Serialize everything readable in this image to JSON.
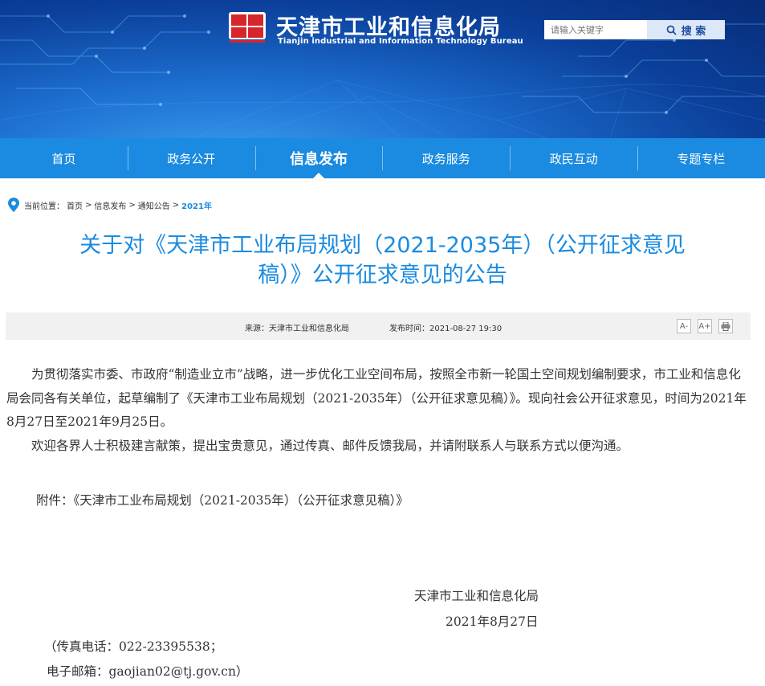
{
  "header": {
    "title_cn": "天津市工业和信息化局",
    "title_en": "Tianjin industrial and Information Technology Bureau",
    "search": {
      "placeholder": "请输入关键字",
      "button": "搜 索"
    }
  },
  "nav": {
    "items": [
      {
        "label": "首页"
      },
      {
        "label": "政务公开"
      },
      {
        "label": "信息发布"
      },
      {
        "label": "政务服务"
      },
      {
        "label": "政民互动"
      },
      {
        "label": "专题专栏"
      }
    ],
    "active_index": 2
  },
  "breadcrumb": {
    "prefix": "当前位置：",
    "items": [
      "首页",
      "信息发布",
      "通知公告",
      "2021年"
    ],
    "separator": ">"
  },
  "article": {
    "title_line1": "关于对《天津市工业布局规划（2021-2035年）（公开征求意见",
    "title_line2": "稿）》公开征求意见的公告",
    "source_label": "来源：",
    "source": "天津市工业和信息化局",
    "date_label": "发布时间：",
    "date": "2021-08-27 19:30",
    "tools": {
      "font_smaller": "A-",
      "font_larger": "A+"
    },
    "paragraph1": "为贯彻落实市委、市政府“制造业立市”战略，进一步优化工业空间布局，按照全市新一轮国土空间规划编制要求，市工业和信息化局会同各有关单位，起草编制了《天津市工业布局规划（2021-2035年）（公开征求意见稿）》。现向社会公开征求意见，时间为2021年8月27日至2021年9月25日。",
    "paragraph2": "欢迎各界人士积极建言献策，提出宝贵意见，通过传真、邮件反馈我局，并请附联系人与联系方式以便沟通。",
    "attachment": "附件：《天津市工业布局规划（2021-2035年）（公开征求意见稿）》",
    "signature_org": "天津市工业和信息化局",
    "signature_date": "2021年8月27日",
    "fax": "（传真电话：022-23395538；",
    "email": "电子邮箱：gaojian02@tj.gov.cn）"
  },
  "colors": {
    "nav_bg": "#1a8be0",
    "title": "#1a8be0",
    "banner_dark": "#0b3f9a",
    "emblem_red": "#d6262c"
  }
}
